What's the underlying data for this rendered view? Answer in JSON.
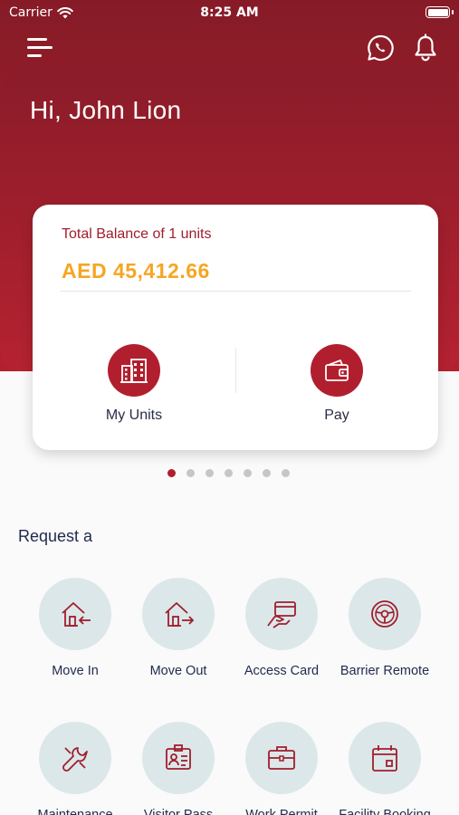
{
  "status_bar": {
    "carrier": "Carrier",
    "time": "8:25 AM"
  },
  "header": {
    "greeting": "Hi, John Lion"
  },
  "balance_card": {
    "label": "Total Balance of 1 units",
    "amount": "AED 45,412.66",
    "actions": [
      {
        "label": "My Units",
        "icon": "building-icon"
      },
      {
        "label": "Pay",
        "icon": "wallet-icon"
      }
    ]
  },
  "carousel": {
    "page_count": 7,
    "active_index": 0
  },
  "request_section": {
    "title": "Request a",
    "services": [
      {
        "label": "Move In",
        "icon": "move-in-icon"
      },
      {
        "label": "Move Out",
        "icon": "move-out-icon"
      },
      {
        "label": "Access Card",
        "icon": "access-card-icon"
      },
      {
        "label": "Barrier Remote",
        "icon": "steering-wheel-icon"
      },
      {
        "label": "Maintenance",
        "icon": "maintenance-icon"
      },
      {
        "label": "Visitor Pass",
        "icon": "visitor-pass-icon"
      },
      {
        "label": "Work Permit",
        "icon": "briefcase-icon"
      },
      {
        "label": "Facility Booking",
        "icon": "calendar-icon"
      }
    ]
  },
  "colors": {
    "brand_red": "#a01e2c",
    "accent_orange": "#f5a623",
    "service_circle": "#dce7ea",
    "text_dark": "#1f2a4d"
  }
}
